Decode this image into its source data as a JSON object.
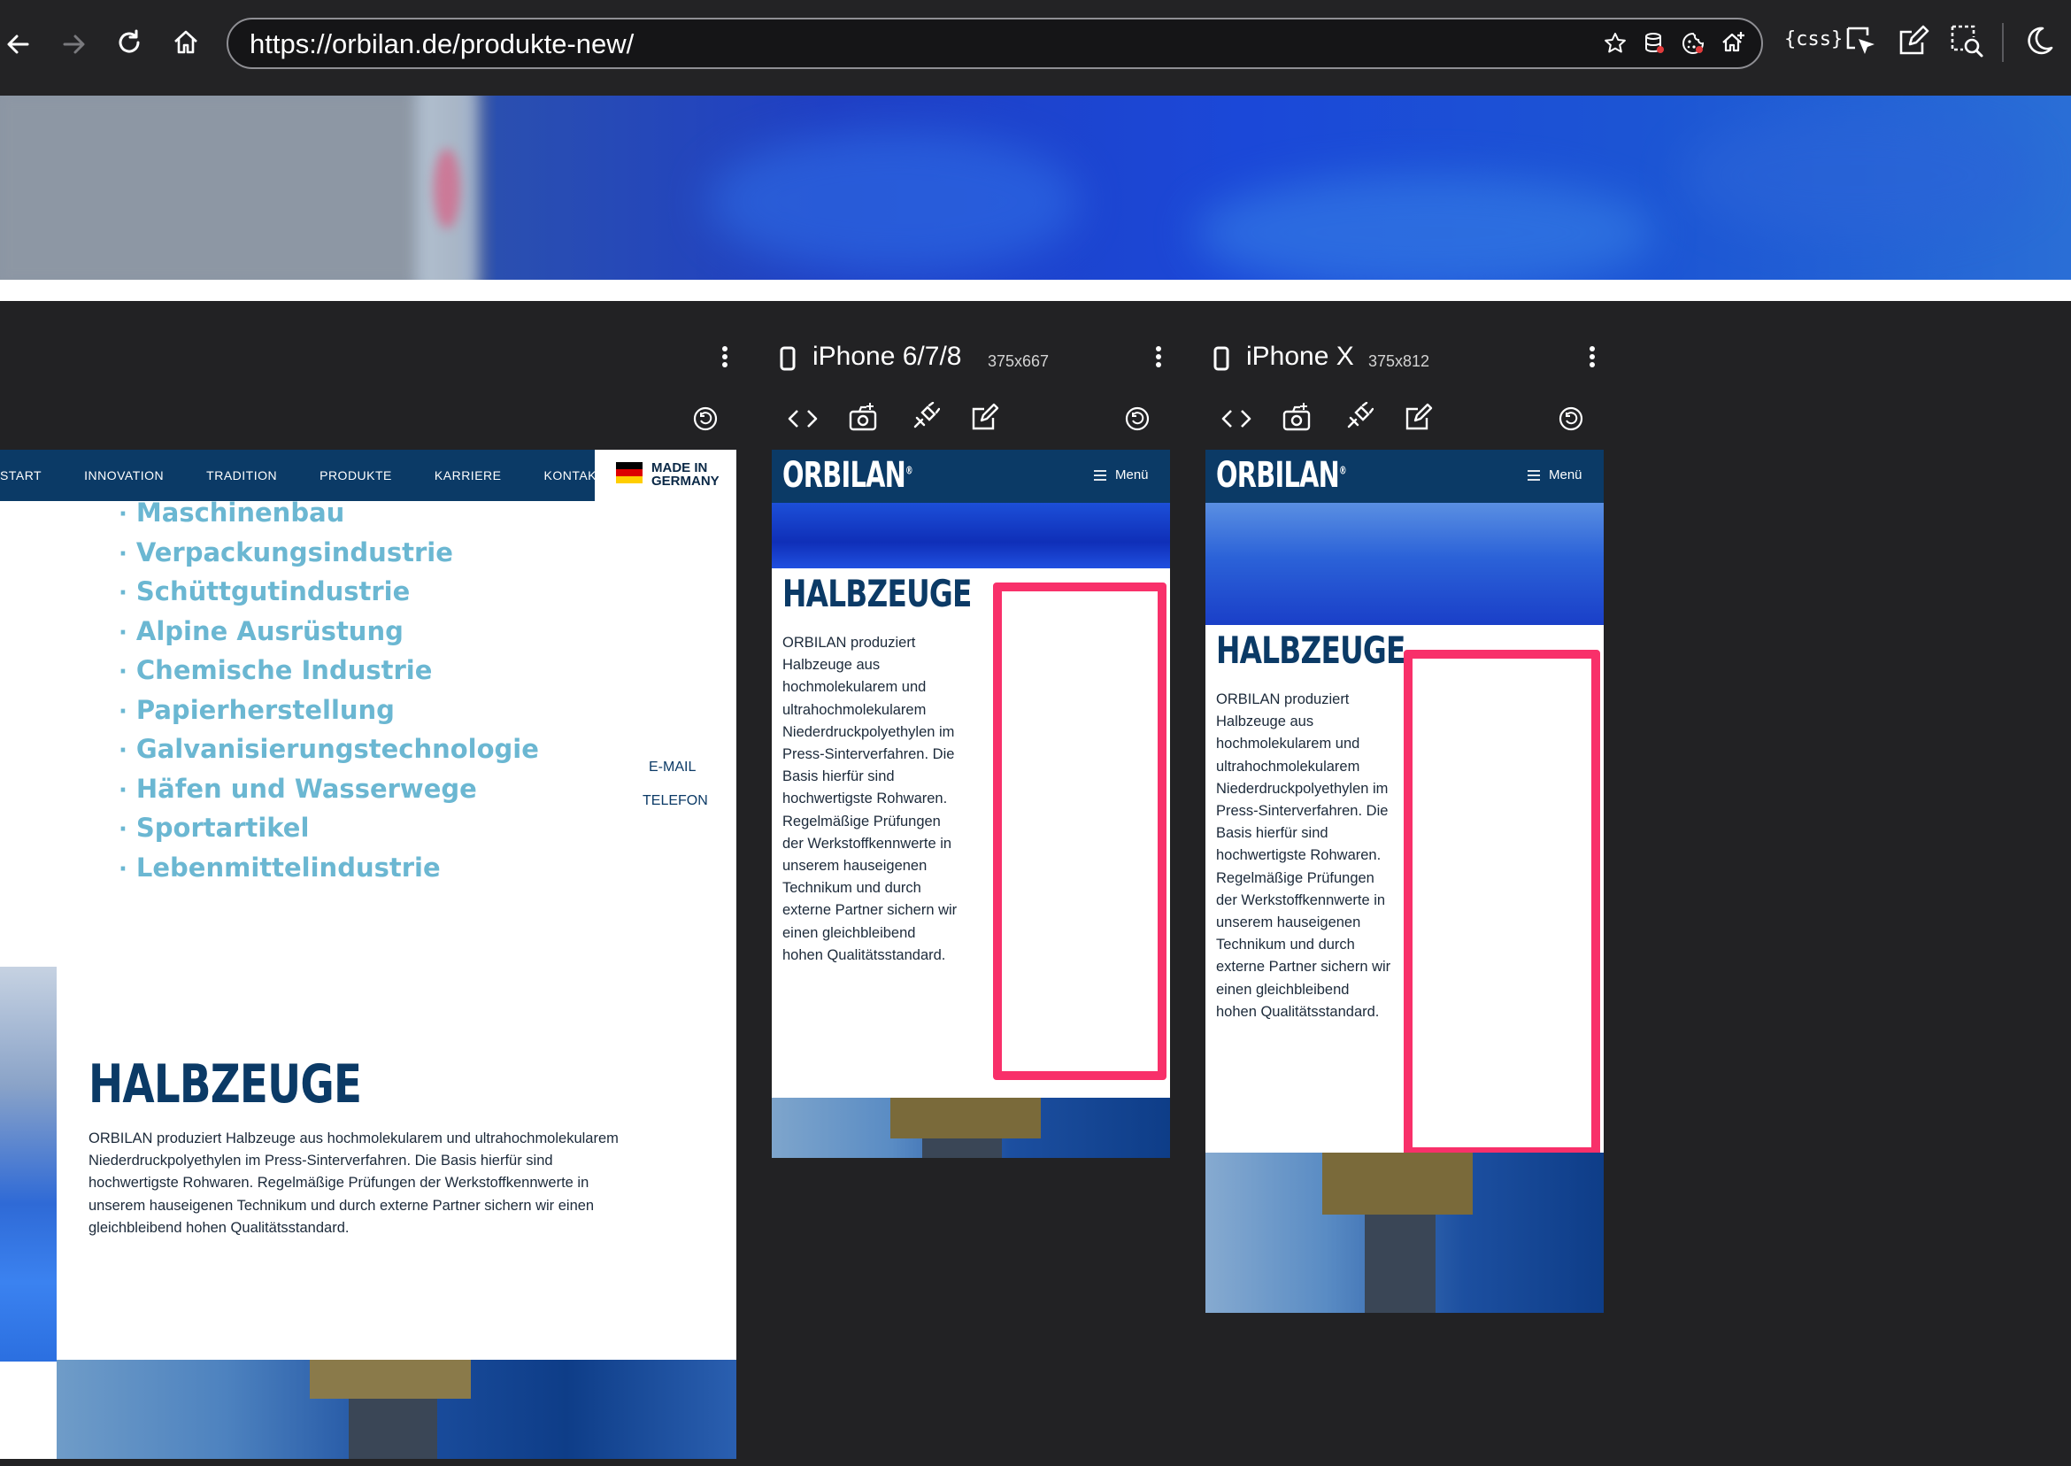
{
  "browser": {
    "url": "https://orbilan.de/produkte-new/",
    "css_label": "{css}"
  },
  "colors": {
    "brand_navy": "#0b3a66",
    "accent_blue": "#6bb7d2",
    "highlight": "#f8306a"
  },
  "desktop": {
    "nav": [
      "START",
      "INNOVATION",
      "TRADITION",
      "PRODUKTE",
      "KARRIERE",
      "KONTAKT"
    ],
    "made_in": [
      "MADE IN",
      "GERMANY"
    ],
    "industries": [
      "Maschinenbau",
      "Verpackungsindustrie",
      "Schüttgutindustrie",
      "Alpine Ausrüstung",
      "Chemische Industrie",
      "Papierherstellung",
      "Galvanisierungstechnologie",
      "Häfen und Wasserwege",
      "Sportartikel",
      "Lebenmittelindustrie"
    ],
    "side_links": [
      "E-MAIL",
      "TELEFON"
    ],
    "heading": "HALBZEUGE",
    "text_lines": [
      "ORBILAN produziert Halbzeuge aus hochmolekularem und ultrahochmolekularem",
      "Niederdruckpolyethylen im Press-Sinterverfahren. Die Basis hierfür sind",
      "hochwertigste Rohwaren. Regelmäßige Prüfungen der Werkstoffkennwerte in",
      "unserem hauseigenen Technikum und durch externe Partner sichern wir einen",
      "gleichbleibend hohen Qualitätsstandard."
    ]
  },
  "devices": [
    {
      "name": "iPhone 6/7/8",
      "size": "375x667"
    },
    {
      "name": "iPhone X",
      "size": "375x812"
    }
  ],
  "mobile": {
    "logo": "ORBILAN",
    "logo_mark": "®",
    "menu": "Menü",
    "heading": "HALBZEUGE",
    "text_lines": [
      "ORBILAN produziert",
      "Halbzeuge aus",
      "hochmolekularem und",
      "ultrahochmolekularem",
      "Niederdruckpolyethylen im",
      "Press-Sinterverfahren. Die",
      "Basis hierfür sind",
      "hochwertigste Rohwaren.",
      "Regelmäßige Prüfungen",
      "der Werkstoffkennwerte in",
      "unserem hauseigenen",
      "Technikum und durch",
      "externe Partner sichern wir",
      "einen gleichbleibend",
      "hohen Qualitätsstandard."
    ]
  }
}
